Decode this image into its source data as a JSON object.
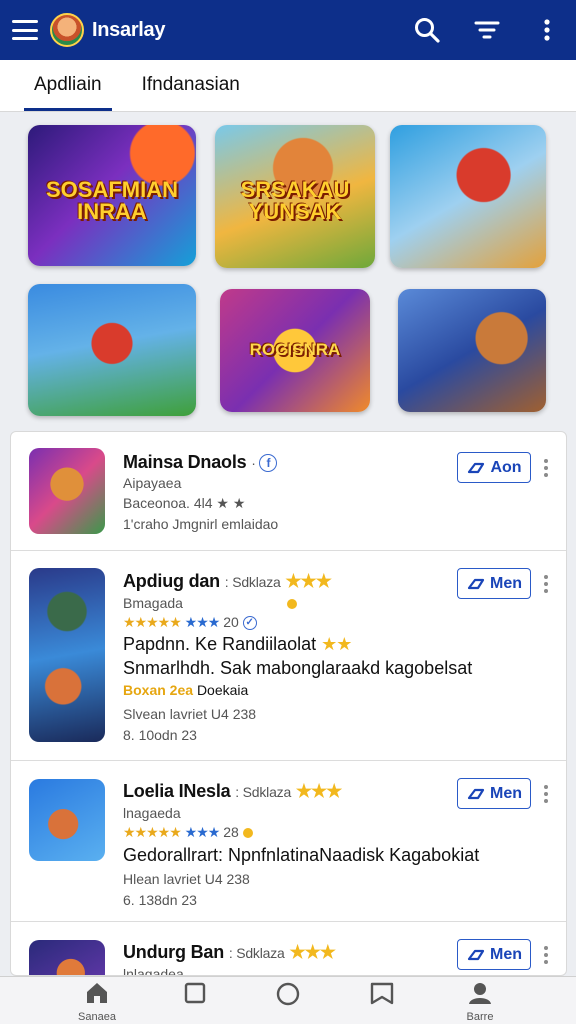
{
  "appbar": {
    "title": "Insarlay",
    "icons": [
      "menu-icon",
      "avatar-logo",
      "search-icon",
      "filter-icon",
      "more-vert-icon"
    ],
    "color": "#0d2f8a"
  },
  "tabs": [
    {
      "label": "Apdliain",
      "active": true
    },
    {
      "label": "Ifndanasian",
      "active": false
    }
  ],
  "banners": [
    {
      "art_text": "SOSAFMIAN INRAA"
    },
    {
      "art_text": "SRSAKAU YUNSAK"
    },
    {
      "art_text": ""
    },
    {
      "art_text": ""
    },
    {
      "art_text": "ROCISNRA"
    },
    {
      "art_text": ""
    }
  ],
  "apps": [
    {
      "title": "Mainsa Dnaols",
      "dev": "",
      "line1": "Aipayaea",
      "line2": "Baceonoa. 4l4 ★ ★",
      "line3": "1'craho Jmgnirl emlaidao",
      "action": "Aon"
    },
    {
      "title": "Apdiug dan",
      "dev": "Sdklaza",
      "line1": "Bmagada",
      "rating": "20",
      "big1": "Papdnn. Ke Randiilaolat",
      "big2": "Snmarlhdh. Sak mabonglaraakd kagobelsat",
      "gold": "Boxan 2ea",
      "gold_rest": "Doekaia",
      "line4": "Slvean lavriet U4 238",
      "line5": "8. 10odn 23",
      "action": "Men"
    },
    {
      "title": "Loelia INesla",
      "dev": "Sdklaza",
      "line1": "lnagaeda",
      "rating": "28",
      "big1": "Gedorallrart: NpnfnlatinaNaadisk Kagabokiat",
      "line4": "Hlean lavriet U4 238",
      "line5": "6. 138dn 23",
      "action": "Men"
    },
    {
      "title": "Undurg Ban",
      "dev": "Sdklaza",
      "line1": "lnlagadea",
      "action": "Men"
    }
  ],
  "bottom_nav": [
    {
      "label": "Sanaea",
      "icon": "home-icon"
    },
    {
      "label": "",
      "icon": "square-icon"
    },
    {
      "label": "",
      "icon": "circle-icon"
    },
    {
      "label": "",
      "icon": "bookmark-icon"
    },
    {
      "label": "Barre",
      "icon": "person-icon"
    }
  ]
}
